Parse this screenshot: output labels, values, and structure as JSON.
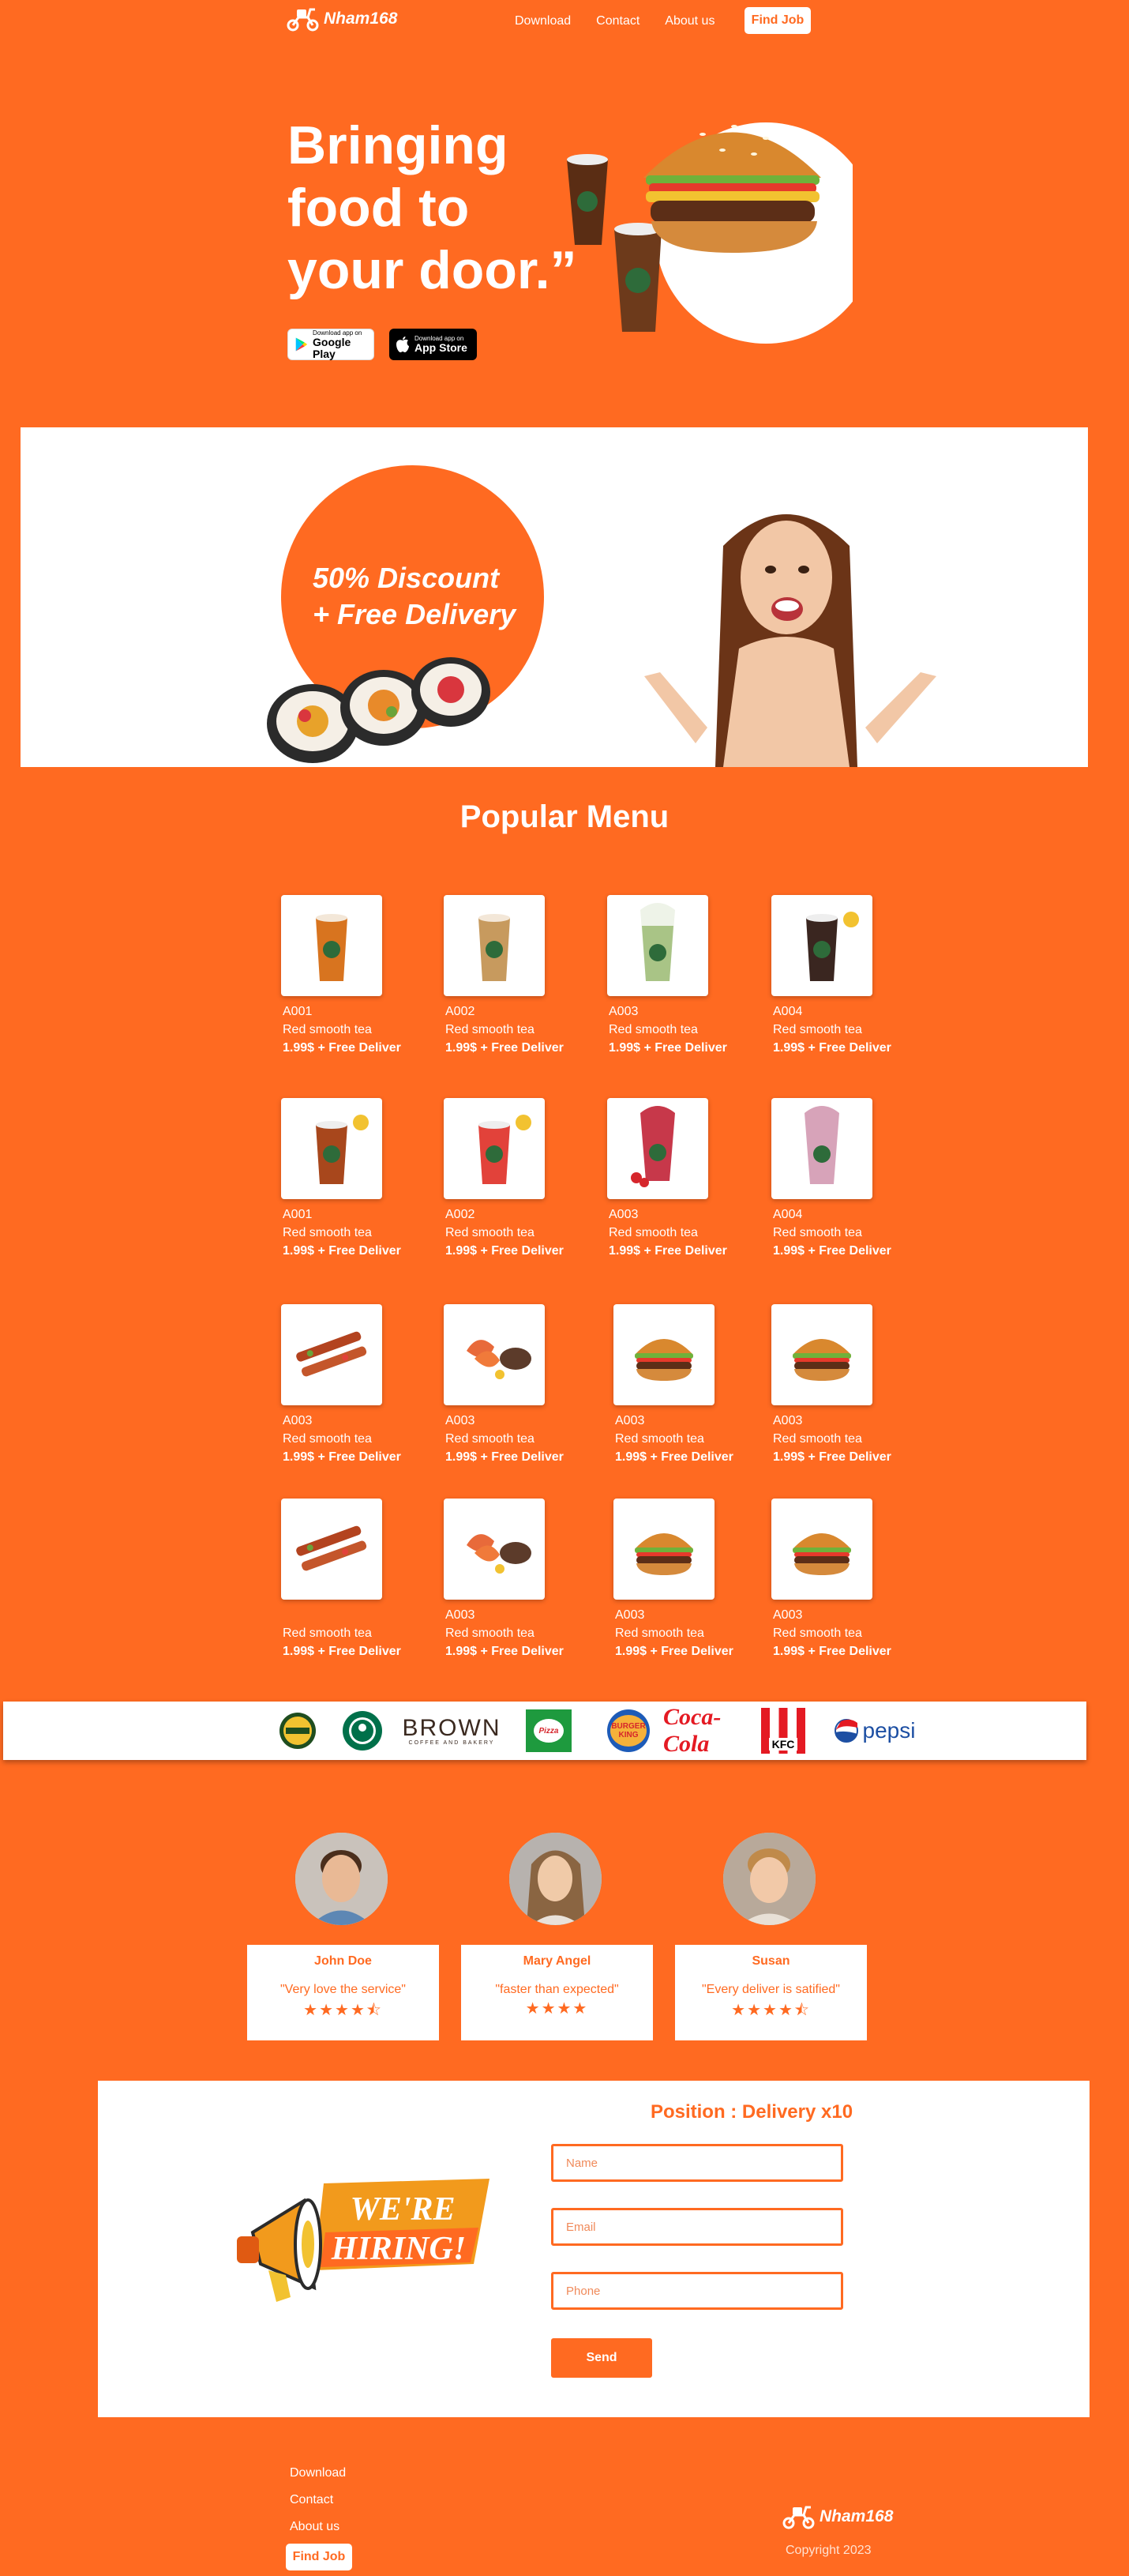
{
  "brand": {
    "name": "Nham168"
  },
  "nav": {
    "links": [
      "Download",
      "Contact",
      "About us"
    ],
    "cta": "Find Job"
  },
  "hero": {
    "title_line1": "Bringing",
    "title_line2": "food to",
    "title_line3": "your door.”",
    "google_small": "Download app on",
    "google_big": "Google Play",
    "apple_small": "Download app on",
    "apple_big": "App Store"
  },
  "promo": {
    "line1": "50% Discount",
    "line2": "+ Free Delivery"
  },
  "menu": {
    "title": "Popular Menu",
    "items": [
      {
        "code": "A001",
        "name": "Red smooth tea",
        "price": "1.99$ + Free Deliver",
        "icon": "iced-tea-orange"
      },
      {
        "code": "A002",
        "name": "Red smooth tea",
        "price": "1.99$ + Free Deliver",
        "icon": "iced-tea-caramel"
      },
      {
        "code": "A003",
        "name": "Red smooth tea",
        "price": "1.99$ + Free Deliver",
        "icon": "iced-tea-green"
      },
      {
        "code": "A004",
        "name": "Red smooth tea",
        "price": "1.99$ + Free Deliver",
        "icon": "iced-tea-dark"
      },
      {
        "code": "A001",
        "name": "Red smooth tea",
        "price": "1.99$ + Free Deliver",
        "icon": "iced-tea-brown"
      },
      {
        "code": "A002",
        "name": "Red smooth tea",
        "price": "1.99$ + Free Deliver",
        "icon": "iced-tea-red"
      },
      {
        "code": "A003",
        "name": "Red smooth tea",
        "price": "1.99$ + Free Deliver",
        "icon": "smoothie-strawberry"
      },
      {
        "code": "A004",
        "name": "Red smooth tea",
        "price": "1.99$ + Free Deliver",
        "icon": "smoothie-pink"
      },
      {
        "code": "A003",
        "name": "Red smooth tea",
        "price": "1.99$ + Free Deliver",
        "icon": "skewers"
      },
      {
        "code": "A003",
        "name": "Red smooth tea",
        "price": "1.99$ + Free Deliver",
        "icon": "shrimp-steak"
      },
      {
        "code": "A003",
        "name": "Red smooth tea",
        "price": "1.99$ + Free Deliver",
        "icon": "burger"
      },
      {
        "code": "A003",
        "name": "Red smooth tea",
        "price": "1.99$ + Free Deliver",
        "icon": "burger"
      },
      {
        "code": "",
        "name": "Red smooth tea",
        "price": "1.99$ + Free Deliver",
        "icon": "skewers"
      },
      {
        "code": "A003",
        "name": "Red smooth tea",
        "price": "1.99$ + Free Deliver",
        "icon": "shrimp-steak"
      },
      {
        "code": "A003",
        "name": "Red smooth tea",
        "price": "1.99$ + Free Deliver",
        "icon": "burger"
      },
      {
        "code": "A003",
        "name": "Red smooth tea",
        "price": "1.99$ + Free Deliver",
        "icon": "burger"
      }
    ]
  },
  "brands": {
    "items": [
      "Aroma Amigos",
      "Starbucks",
      "BROWN",
      "Pizza Company",
      "Burger King",
      "Coca-Cola",
      "KFC",
      "pepsi"
    ],
    "brown_label": "BROWN",
    "brown_sub": "COFFEE AND BAKERY",
    "coca_label": "Coca-Cola",
    "kfc_label": "KFC",
    "pepsi_label": "pepsi",
    "bk_label1": "BURGER",
    "bk_label2": "KING",
    "pizza_label": "Pizza"
  },
  "testimonials": [
    {
      "name": "John Doe",
      "quote": "\"Very love the service\"",
      "stars": "★★★★⯪"
    },
    {
      "name": "Mary Angel",
      "quote": "\"faster than expected\"",
      "stars": "★★★★"
    },
    {
      "name": "Susan",
      "quote": "\"Every deliver is satified\"",
      "stars": "★★★★⯪"
    }
  ],
  "hiring": {
    "badge_line1": "WE'RE",
    "badge_line2": "HIRING!",
    "position": "Position : Delivery x10",
    "name_placeholder": "Name",
    "email_placeholder": "Email",
    "phone_placeholder": "Phone",
    "send": "Send"
  },
  "footer": {
    "links": [
      "Download",
      "Contact",
      "About us"
    ],
    "cta": "Find Job",
    "copyright": "Copyright 2023"
  },
  "colors": {
    "accent": "#ff6a21",
    "white": "#ffffff"
  }
}
